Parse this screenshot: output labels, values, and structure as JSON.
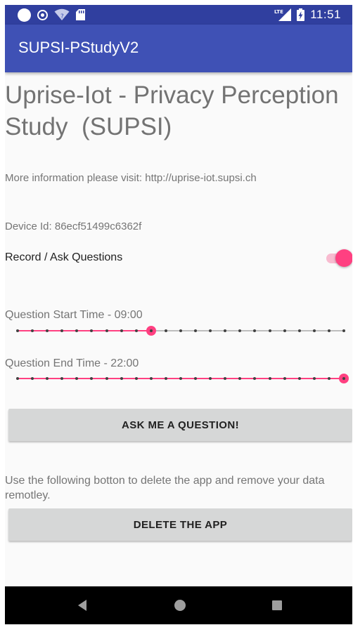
{
  "status_bar": {
    "time": "11:51",
    "network_label": "LTE",
    "icons": [
      "circle-notification-icon",
      "ring-notification-icon",
      "wifi-icon",
      "sd-card-icon",
      "lte-signal-icon",
      "battery-charging-icon"
    ]
  },
  "app_bar": {
    "title": "SUPSI-PStudyV2",
    "color": "#3f51b5",
    "status_color": "#303f9f"
  },
  "main": {
    "heading": "Uprise-Iot - Privacy Perception Study  (SUPSI)",
    "info_text": "More information please visit: http://uprise-iot.supsi.ch",
    "device_id": "Device Id: 86ecf51499c6362f",
    "record_switch": {
      "label": "Record / Ask Questions",
      "on": true
    },
    "start_slider": {
      "label": "Question Start Time  - 09:00",
      "steps": 23,
      "value": 9
    },
    "end_slider": {
      "label": "Question End Time - 22:00",
      "steps": 23,
      "value": 22
    },
    "ask_button": "ASK ME A QUESTION!",
    "delete_hint": "Use the following botton to delete the app and remove your data remotley.",
    "delete_button": "DELETE THE APP"
  },
  "accent_color": "#ff4081",
  "nav_bar": {
    "icons": [
      "back-icon",
      "home-icon",
      "recents-icon"
    ]
  }
}
